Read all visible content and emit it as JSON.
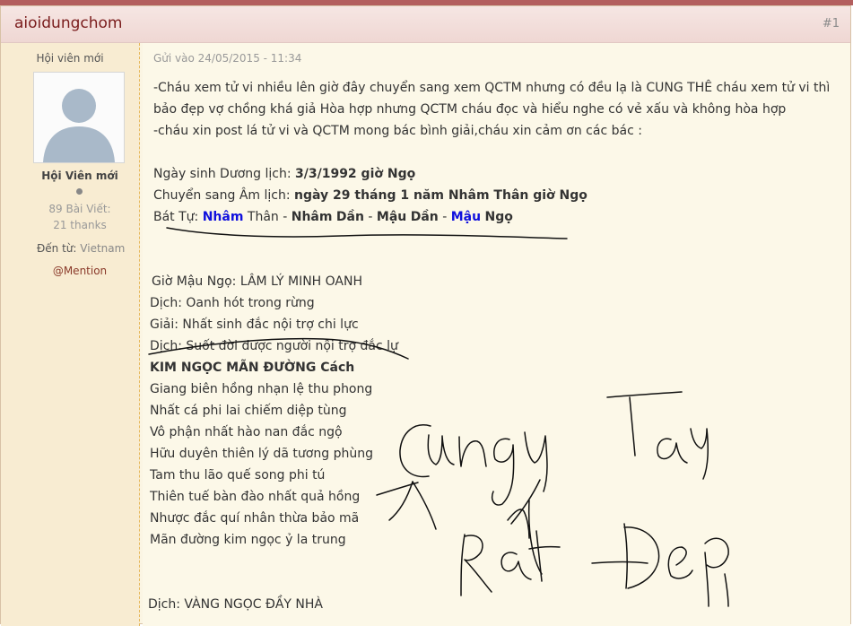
{
  "post": {
    "username": "aioidungchom",
    "post_number": "#1",
    "posted_at": "Gửi vào 24/05/2015 - 11:34"
  },
  "author": {
    "rank_top": "Hội viên mới",
    "rank": "Hội Viên mới",
    "posts": "89 Bài Viết:",
    "thanks": "21 thanks",
    "from_label": "Đến từ:",
    "from_value": "Vietnam",
    "mention": "@Mention"
  },
  "body": {
    "p1": "-Cháu xem tử vi nhiều lên giờ đây chuyển sang xem QCTM nhưng có đều lạ là CUNG THÊ cháu xem tử vi thì",
    "p2": "bảo đẹp vợ chồng khá giả Hòa hợp nhưng QCTM cháu đọc và hiểu nghe có vẻ xấu và không hòa hợp",
    "p3": "-cháu xin post lá tử vi và QCTM mong bác bình giải,cháu xin cảm ơn các bác :",
    "duong_label": "Ngày sinh Dương lịch: ",
    "duong_value": "3/3/1992 giờ Ngọ",
    "am_label": "Chuyển sang Âm lịch: ",
    "am_value": "ngày 29 tháng 1 năm Nhâm Thân giờ Ngọ",
    "battu_label": "Bát Tự: ",
    "battu": [
      "Nhâm",
      "Thân",
      "Nhâm",
      "Dần",
      "Mậu",
      "Dần",
      "Mậu",
      "Ngọ"
    ],
    "battu_sep": " - ",
    "verse": [
      "Giờ Mậu Ngọ: LÂM LÝ MINH OANH",
      "Dịch: Oanh hót trong rừng",
      "Giải: Nhất sinh đắc nội trợ chi lực",
      "Dịch: Suốt đời được người nội trợ đắc lự",
      "KIM NGỌC MÃN ĐƯỜNG Cách",
      "Giang biên hồng nhạn lệ thu phong",
      "Nhất cá phi lai chiếm diệp tùng",
      "Vô phận nhất hào nan đắc ngộ",
      "Hữu duyên thiên lý dã tương phùng",
      "Tam thu lão quế song phi tú",
      "Thiên tuế bàn đào nhất quả hồng",
      "Nhược đắc quí nhân thừa bảo mã",
      "Mãn đường kim ngọc ỷ la trung"
    ],
    "last_line": "Dịch: VÀNG NGỌC ĐẦY NHÀ"
  },
  "colors": {
    "username": "#7a1c1c",
    "highlight_blue": "#1010dd",
    "sidebar_bg": "#f8ecd2",
    "post_bg": "#fcf8e8"
  },
  "icons": {
    "avatar": "default-user-silhouette",
    "status": "offline-dot"
  }
}
